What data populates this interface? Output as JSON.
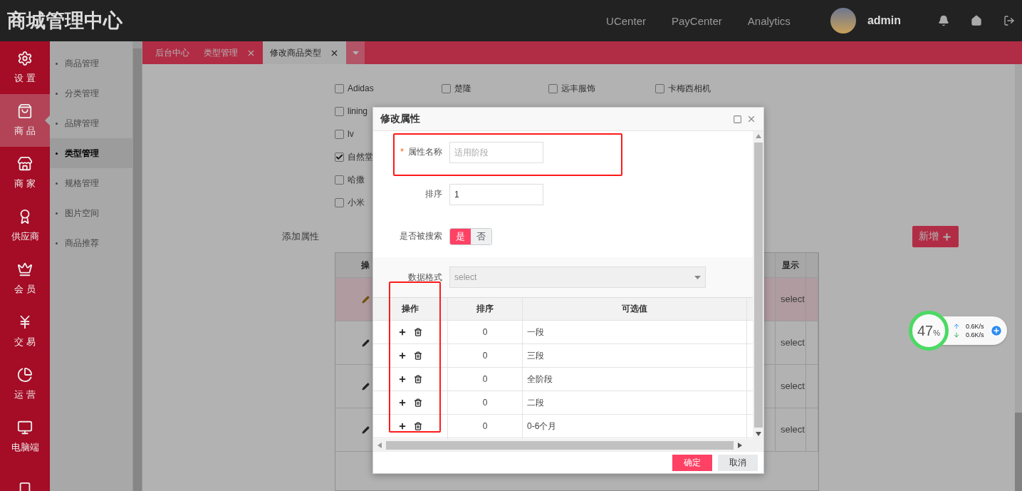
{
  "header": {
    "title": "商城管理中心",
    "links": [
      "UCenter",
      "PayCenter",
      "Analytics"
    ],
    "user": "admin"
  },
  "nav": [
    {
      "kind": "gear",
      "label": "设 置",
      "selected": false
    },
    {
      "kind": "bag",
      "label": "商 品",
      "selected": true
    },
    {
      "kind": "store",
      "label": "商 家",
      "selected": false
    },
    {
      "kind": "award",
      "label": "供应商",
      "selected": false
    },
    {
      "kind": "crown",
      "label": "会 员",
      "selected": false
    },
    {
      "kind": "yen",
      "label": "交 易",
      "selected": false
    },
    {
      "kind": "pie",
      "label": "运 营",
      "selected": false
    },
    {
      "kind": "monitor",
      "label": "电脑端",
      "selected": false
    },
    {
      "kind": "phone",
      "selected": false
    }
  ],
  "submenu": [
    {
      "label": "商品管理",
      "selected": false
    },
    {
      "label": "分类管理",
      "selected": false
    },
    {
      "label": "品牌管理",
      "selected": false
    },
    {
      "label": "类型管理",
      "selected": true
    },
    {
      "label": "规格管理",
      "selected": false
    },
    {
      "label": "图片空间",
      "selected": false
    },
    {
      "label": "商品推荐",
      "selected": false
    }
  ],
  "tabs": [
    {
      "label": "后台中心",
      "closable": false,
      "selected": false
    },
    {
      "label": "类型管理",
      "closable": true,
      "selected": false
    },
    {
      "label": "修改商品类型",
      "closable": true,
      "selected": true
    }
  ],
  "brand_rows": [
    [
      {
        "label": "Adidas",
        "checked": false
      },
      {
        "label": "楚隆",
        "checked": false
      },
      {
        "label": "远丰服饰",
        "checked": false
      },
      {
        "label": "卡梅西相机",
        "checked": false
      }
    ],
    [
      {
        "label": "lining",
        "checked": false
      }
    ],
    [
      {
        "label": "lv",
        "checked": false
      }
    ],
    [
      {
        "label": "自然堂",
        "checked": true
      }
    ],
    [
      {
        "label": "哈撒",
        "checked": false
      }
    ],
    [
      {
        "label": "小米",
        "checked": false
      }
    ]
  ],
  "attributes": {
    "label": "添加属性",
    "add_button": "新增",
    "columns": [
      "操",
      "显示"
    ],
    "rows": [
      {
        "display": "select",
        "selected": true
      },
      {
        "display": "select",
        "selected": false
      },
      {
        "display": "select",
        "selected": false
      },
      {
        "display": "select",
        "selected": false
      }
    ]
  },
  "modal": {
    "title": "修改属性",
    "fields": [
      {
        "kind": "text",
        "label": "属性名称",
        "required_mark": "*",
        "placeholder": "适用阶段"
      },
      {
        "kind": "text",
        "label": "排序",
        "value": "1"
      },
      {
        "kind": "toggle",
        "label": "是否被搜索",
        "options": [
          {
            "label": "是",
            "selected": true
          },
          {
            "label": "否",
            "selected": false
          }
        ]
      },
      {
        "kind": "select",
        "label": "数据格式",
        "value": "select",
        "disabled": true
      }
    ],
    "table": {
      "columns": [
        "操作",
        "排序",
        "可选值"
      ],
      "rows": [
        {
          "order": "0",
          "value": "一段"
        },
        {
          "order": "0",
          "value": "三段"
        },
        {
          "order": "0",
          "value": "全阶段"
        },
        {
          "order": "0",
          "value": "二段"
        },
        {
          "order": "0",
          "value": "0-6个月"
        }
      ]
    },
    "buttons": [
      {
        "kind": "primary",
        "label": "确定"
      },
      {
        "kind": "secondary",
        "label": "取消"
      }
    ]
  },
  "widget": {
    "percent": "47",
    "unit": "%",
    "up": "0.6K/s",
    "down": "0.6K/s"
  }
}
